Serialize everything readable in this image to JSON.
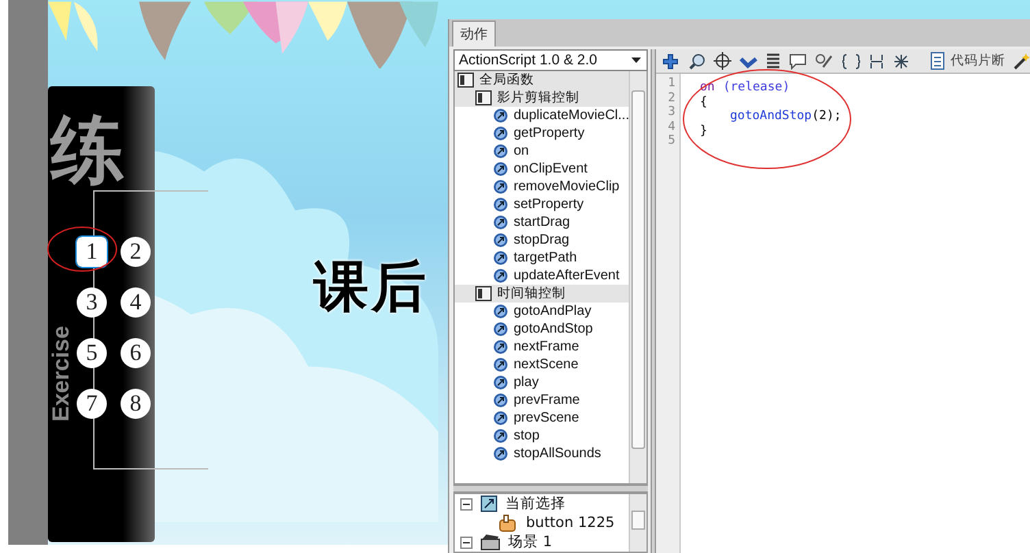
{
  "stage": {
    "calligraphy": "练",
    "vertical_word": "Exercise",
    "heading": "课后",
    "buttons": [
      {
        "label": "1",
        "selected": true
      },
      {
        "label": "2",
        "selected": false
      },
      {
        "label": "3",
        "selected": false
      },
      {
        "label": "4",
        "selected": false
      },
      {
        "label": "5",
        "selected": false
      },
      {
        "label": "6",
        "selected": false
      },
      {
        "label": "7",
        "selected": false
      },
      {
        "label": "8",
        "selected": false
      }
    ]
  },
  "panel": {
    "tab": "动作",
    "dropdown": "ActionScript 1.0 & 2.0",
    "tree": [
      {
        "label": "全局函数",
        "kind": "folder",
        "children": [
          {
            "label": "影片剪辑控制",
            "kind": "folder",
            "children": [
              {
                "label": "duplicateMovieCl...",
                "kind": "function"
              },
              {
                "label": "getProperty",
                "kind": "function"
              },
              {
                "label": "on",
                "kind": "function"
              },
              {
                "label": "onClipEvent",
                "kind": "function"
              },
              {
                "label": "removeMovieClip",
                "kind": "function"
              },
              {
                "label": "setProperty",
                "kind": "function"
              },
              {
                "label": "startDrag",
                "kind": "function"
              },
              {
                "label": "stopDrag",
                "kind": "function"
              },
              {
                "label": "targetPath",
                "kind": "function"
              },
              {
                "label": "updateAfterEvent",
                "kind": "function"
              }
            ]
          },
          {
            "label": "时间轴控制",
            "kind": "folder",
            "children": [
              {
                "label": "gotoAndPlay",
                "kind": "function"
              },
              {
                "label": "gotoAndStop",
                "kind": "function"
              },
              {
                "label": "nextFrame",
                "kind": "function"
              },
              {
                "label": "nextScene",
                "kind": "function"
              },
              {
                "label": "play",
                "kind": "function"
              },
              {
                "label": "prevFrame",
                "kind": "function"
              },
              {
                "label": "prevScene",
                "kind": "function"
              },
              {
                "label": "stop",
                "kind": "function"
              },
              {
                "label": "stopAllSounds",
                "kind": "function"
              }
            ]
          }
        ]
      }
    ],
    "outline": [
      {
        "label": "当前选择",
        "kind": "selection",
        "expanded": true,
        "children": [
          {
            "label": "button 1225",
            "kind": "button"
          }
        ]
      },
      {
        "label": "场景 1",
        "kind": "scene",
        "expanded": true
      }
    ],
    "snippets_button": "代码片断",
    "code": [
      {
        "number": "1",
        "tokens": [
          {
            "text": "on",
            "kind": "keyword"
          },
          {
            "text": "(release)",
            "kind": "event"
          }
        ]
      },
      {
        "number": "2",
        "tokens": [
          {
            "text": "{",
            "kind": "plain"
          }
        ]
      },
      {
        "number": "3",
        "indent": true,
        "tokens": [
          {
            "text": "gotoAndStop",
            "kind": "function"
          },
          {
            "text": "(2);",
            "kind": "plain"
          }
        ]
      },
      {
        "number": "4",
        "tokens": [
          {
            "text": "}",
            "kind": "plain"
          }
        ]
      },
      {
        "number": "5"
      }
    ]
  }
}
